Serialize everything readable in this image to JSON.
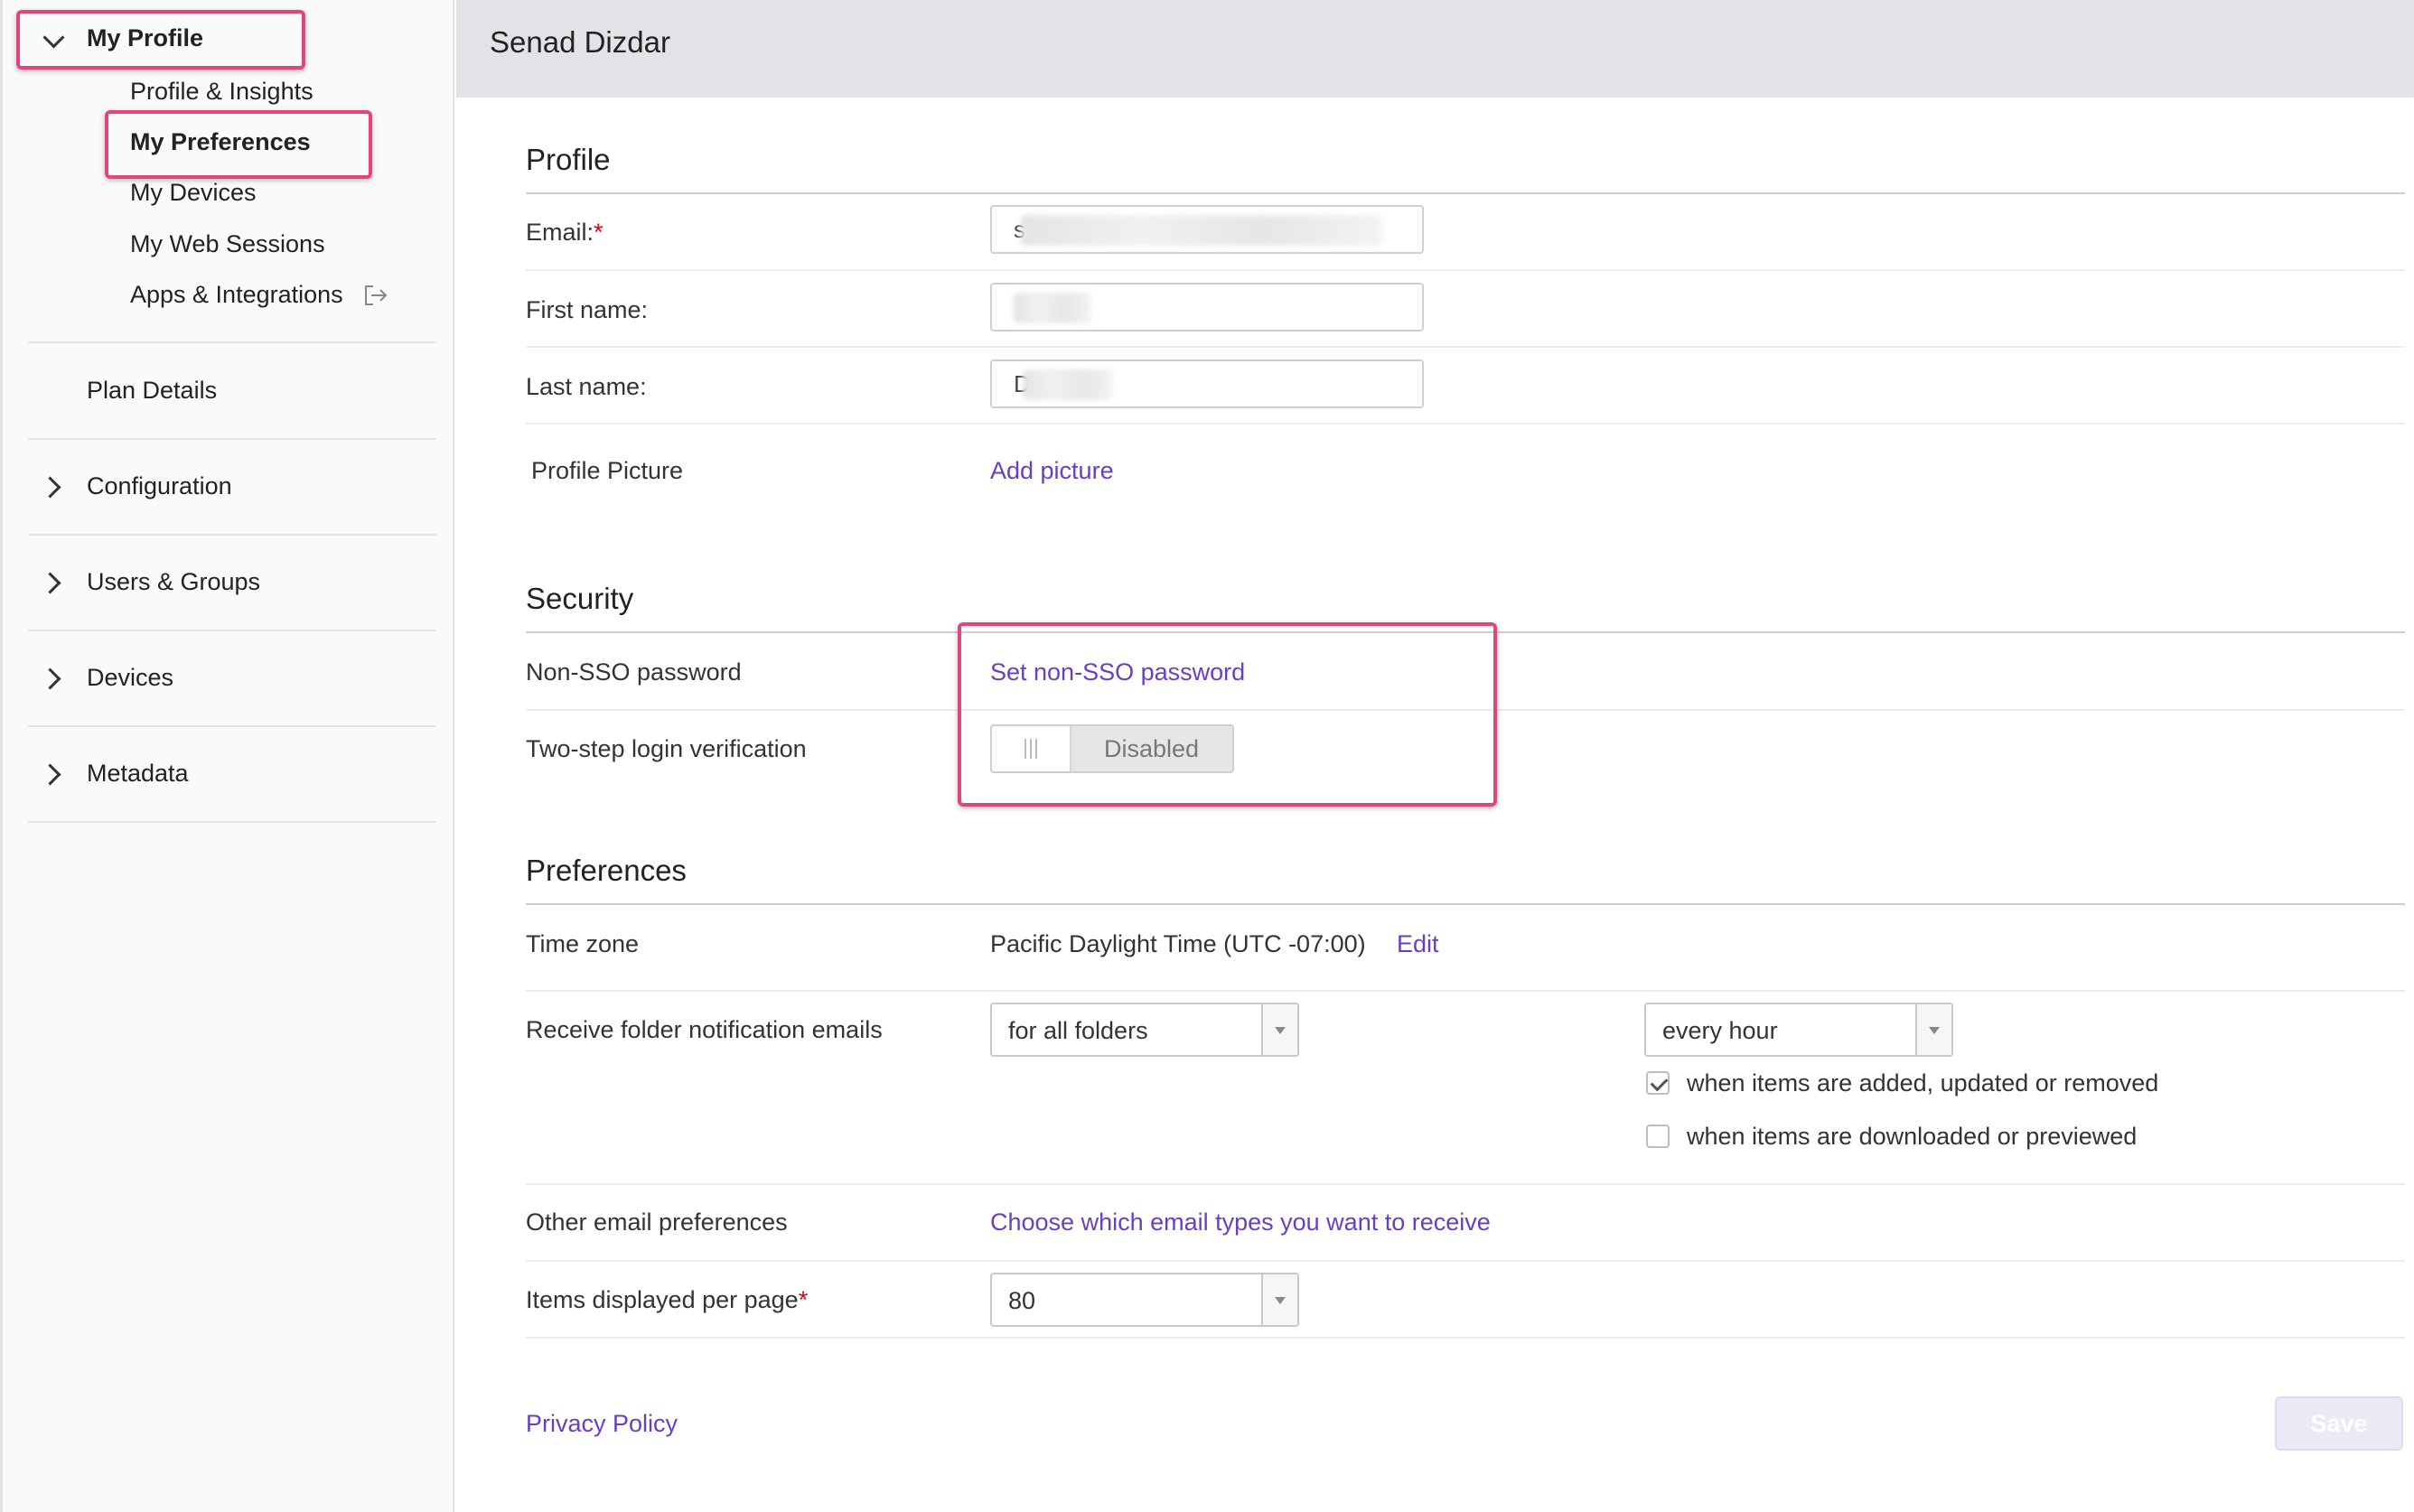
{
  "sidebar": {
    "my_profile": "My Profile",
    "sub_items": [
      "Profile & Insights",
      "My Preferences",
      "My Devices",
      "My Web Sessions",
      "Apps & Integrations"
    ],
    "plan_details": "Plan Details",
    "groups": [
      "Configuration",
      "Users & Groups",
      "Devices",
      "Metadata"
    ]
  },
  "header": {
    "title": "Senad Dizdar"
  },
  "profile": {
    "section_title": "Profile",
    "email_label": "Email:",
    "email_value": "s",
    "first_name_label": "First name:",
    "last_name_label": "Last name:",
    "last_name_value": "D",
    "picture_label": "Profile Picture",
    "add_picture": "Add picture"
  },
  "security": {
    "section_title": "Security",
    "non_sso_label": "Non-SSO password",
    "non_sso_link": "Set non-SSO password",
    "two_step_label": "Two-step login verification",
    "two_step_state": "Disabled"
  },
  "preferences": {
    "section_title": "Preferences",
    "time_zone_label": "Time zone",
    "time_zone_value": "Pacific Daylight Time (UTC -07:00)",
    "time_zone_edit": "Edit",
    "folder_notif_label": "Receive folder notification emails",
    "folder_scope": "for all folders",
    "frequency": "every hour",
    "check_added_label": "when items are added, updated or removed",
    "check_added_checked": true,
    "check_downloaded_label": "when items are downloaded or previewed",
    "check_downloaded_checked": false,
    "other_email_label": "Other email preferences",
    "other_email_link": "Choose which email types you want to receive",
    "items_per_page_label": "Items displayed per page",
    "items_per_page_value": "80"
  },
  "footer": {
    "privacy_policy": "Privacy Policy",
    "save": "Save"
  },
  "colors": {
    "accent_link": "#6a3fbd",
    "highlight": "#e0457b",
    "required": "#d0021b"
  },
  "icons": {
    "logout": "external-link-icon"
  }
}
